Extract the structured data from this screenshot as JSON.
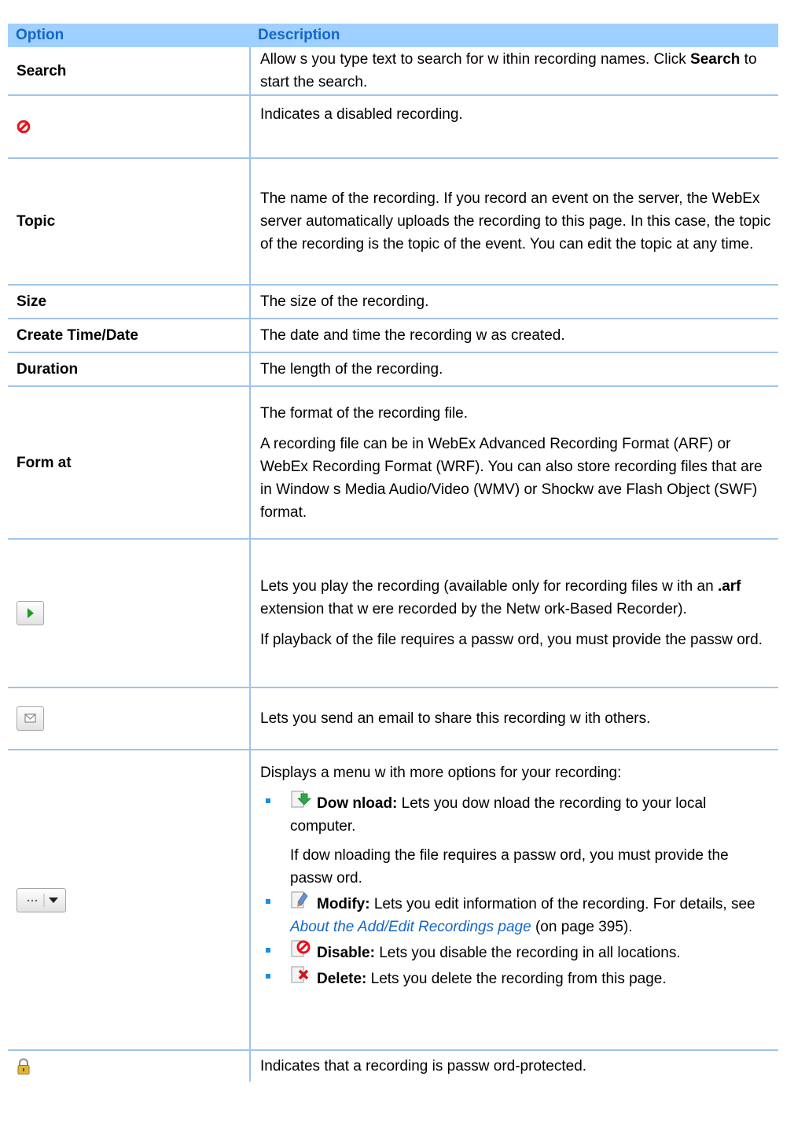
{
  "table": {
    "header": {
      "option": "Option",
      "description": "Description"
    },
    "search": {
      "option": "Search",
      "desc_a": "Allow s you type text to search for w ithin recording names. Click",
      "desc_b": "Search",
      "desc_c": "to start the search."
    },
    "disabled_icon": {
      "desc": "Indicates a disabled recording."
    },
    "topic": {
      "option": "Topic",
      "desc": "The name of the recording. If you record an event on the server, the WebEx server automatically uploads the recording to this page. In this case, the topic of the recording is the topic of the event. You can edit the topic at any time."
    },
    "size": {
      "option": "Size",
      "desc": "The size of the recording."
    },
    "create": {
      "option": "Create Time/Date",
      "desc": "The date and time the recording w as created."
    },
    "duration": {
      "option": "Duration",
      "desc": "The length of the recording."
    },
    "format": {
      "option": "Form at",
      "desc1": "The format of the recording file.",
      "desc2": "A recording file can be in WebEx Advanced Recording Format (ARF) or WebEx Recording Format (WRF). You can also store recording files that are in Window s Media Audio/Video (WMV) or Shockw ave Flash Object (SWF) format."
    },
    "play": {
      "desc1a": "Lets you play the recording (available only for recording files w ith an",
      "desc1b": ".arf",
      "desc1c": "extension that w ere recorded by the Netw ork-Based Recorder).",
      "desc2": "If playback of the file requires a passw ord, you must provide the passw ord."
    },
    "email": {
      "desc": "Lets you send an email to share this recording w ith others."
    },
    "more": {
      "intro": "Displays a menu w ith more options for your recording:",
      "download_label": "Dow nload:",
      "download_desc": "Lets you dow nload the recording to your local computer.",
      "download_sub": "If dow nloading the file requires a passw ord, you must provide the passw ord.",
      "modify_label": "Modify:",
      "modify_desc": "Lets you edit information of the recording. For details, see",
      "modify_link": "About the Add/Edit Recordings page",
      "modify_after": "(on page 395).",
      "disable_label": "Disable:",
      "disable_desc": "Lets you disable the recording in all locations.",
      "delete_label": "Delete:",
      "delete_desc": "Lets you delete the recording from this page."
    },
    "lock": {
      "desc": "Indicates that a recording is passw ord-protected."
    }
  },
  "colors": {
    "header_bg": "#9fd0ff",
    "header_text": "#1466c8",
    "rule": "#9fc4ea",
    "bullet": "#1a8ee6",
    "disabled_red": "#e8101a"
  },
  "icons": [
    "disabled-icon",
    "play-button-icon",
    "email-button-icon",
    "more-options-button-icon",
    "download-icon",
    "modify-icon",
    "disable-icon",
    "delete-icon",
    "lock-icon"
  ]
}
